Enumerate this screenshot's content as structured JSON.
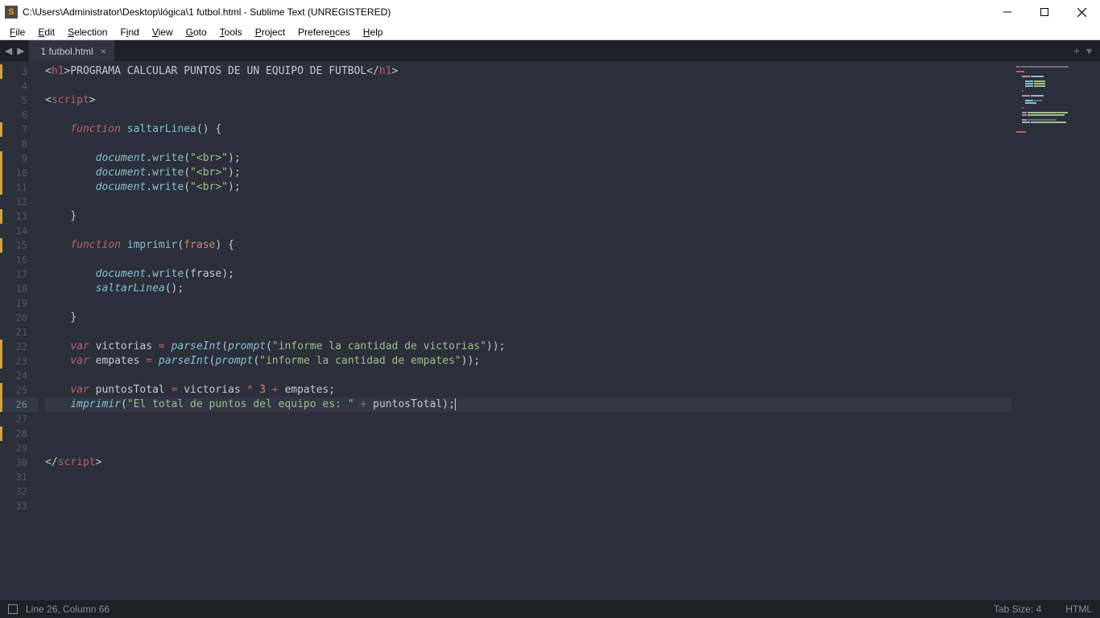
{
  "window": {
    "title": "C:\\Users\\Administrator\\Desktop\\lógica\\1 futbol.html - Sublime Text (UNREGISTERED)"
  },
  "menu": {
    "file": "File",
    "edit": "Edit",
    "selection": "Selection",
    "find": "Find",
    "view": "View",
    "goto": "Goto",
    "tools": "Tools",
    "project": "Project",
    "preferences": "Preferences",
    "help": "Help"
  },
  "tab": {
    "name": "1 futbol.html",
    "close": "×"
  },
  "tabright": {
    "plus": "+",
    "down": "▾"
  },
  "lines": {
    "start": 3,
    "end": 33,
    "modified": [
      3,
      7,
      9,
      10,
      11,
      13,
      15,
      22,
      23,
      25,
      26,
      28
    ],
    "current": 26
  },
  "code": {
    "h1_text": "PROGRAMA CALCULAR PUNTOS DE UN EQUIPO DE FUTBOL",
    "fn1": "saltarLinea",
    "doc": "document",
    "write": "write",
    "br": "\"<br>\"",
    "fn2": "imprimir",
    "param2": "frase",
    "callSaltar": "saltarLinea",
    "var1": "victorias",
    "var2": "empates",
    "var3": "puntosTotal",
    "parseInt": "parseInt",
    "prompt": "prompt",
    "str_vict": "\"informe la cantidad de victorias\"",
    "str_emp": "\"informe la cantidad de empates\"",
    "mult": "3",
    "imp": "imprimir",
    "str_tot": "\"El total de puntos del equipo es: \""
  },
  "status": {
    "pos": "Line 26, Column 66",
    "tab": "Tab Size: 4",
    "lang": "HTML"
  }
}
